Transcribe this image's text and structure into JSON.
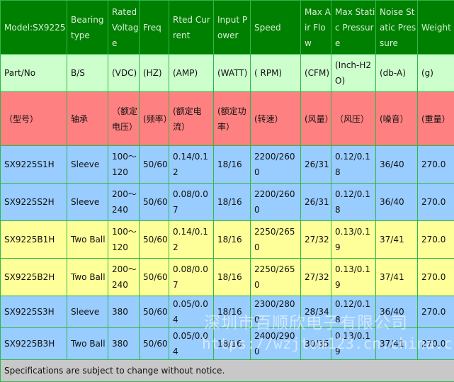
{
  "header": [
    "Model:SX9225",
    "Bearing type",
    "Rated Voltage",
    "Freq",
    "Rted Current",
    "Input Power",
    "Speed",
    "Max Air Flow",
    "Max Static Pressure",
    "Noise Static Pressure",
    "Weight"
  ],
  "units": [
    "Part/No",
    "B/S",
    "(VDC)",
    "(HZ)",
    "(AMP)",
    "(WATT)",
    "( RPM)",
    "(CFM)",
    "(Inch-H2O)",
    "(db-A)",
    "(g)"
  ],
  "chinese": [
    "（型号）",
    "轴承",
    "（额定电压）",
    "(频率）",
    "(额定电流）",
    "(额定功率）",
    "(转速）",
    "(风量）",
    "（风压）",
    "(噪音）",
    "(重量）"
  ],
  "rows": [
    {
      "color": "#99ccff",
      "cells": [
        "SX9225S1H",
        "Sleeve",
        "100～120",
        "50/60",
        "0.14/0.12",
        "18/16",
        "2200/2600",
        "26/31",
        "0.12/0.18",
        "36/40",
        "270.0"
      ]
    },
    {
      "color": "#99ccff",
      "cells": [
        "SX9225S2H",
        "Sleeve",
        "200～240",
        "50/60",
        "0.08/0.07",
        "18/16",
        "2200/2600",
        "26/31",
        "0.12/0.18",
        "36/40",
        "270.0"
      ]
    },
    {
      "color": "#ffff99",
      "cells": [
        "SX9225B1H",
        "Two Ball",
        "100～120",
        "50/60",
        "0.14/0.12",
        "18/16",
        "2250/2650",
        "27/32",
        "0.13/0.19",
        "37/41",
        "270.0"
      ]
    },
    {
      "color": "#ffff99",
      "cells": [
        "SX9225B2H",
        "Two Ball",
        "200～240",
        "50/60",
        "0.08/0.07",
        "18/16",
        "2250/2650",
        "27/32",
        "0.13/0.19",
        "37/41",
        "270.0"
      ]
    },
    {
      "color": "#99ccff",
      "cells": [
        "SX9225S3H",
        "Sleeve",
        "380",
        "50/60",
        "0.05/0.04",
        "18/16",
        "2300/2800",
        "28/34",
        "0.12/0.18",
        "36/40",
        "270.0"
      ]
    },
    {
      "color": "#99ccff",
      "cells": [
        "SX9225B3H",
        "Two Ball",
        "380",
        "50/60",
        "0.05/0.04",
        "18/16",
        "2400/2900",
        "30/35",
        "0.13/0.19",
        "37/41",
        "270.0"
      ]
    }
  ],
  "footer": "Specifications are subject to change without notice.",
  "watermark": {
    "company": "深圳市百顺欣电子有限公司",
    "url": "https://wzjtom123.cn.china.cn"
  },
  "colors": {
    "header": "#008000",
    "units": "#ccffcc",
    "chinese": "#ff8080",
    "blue": "#99ccff",
    "yellow": "#ffff99",
    "footer": "#c8c8c8",
    "border": "#2fb84a"
  }
}
